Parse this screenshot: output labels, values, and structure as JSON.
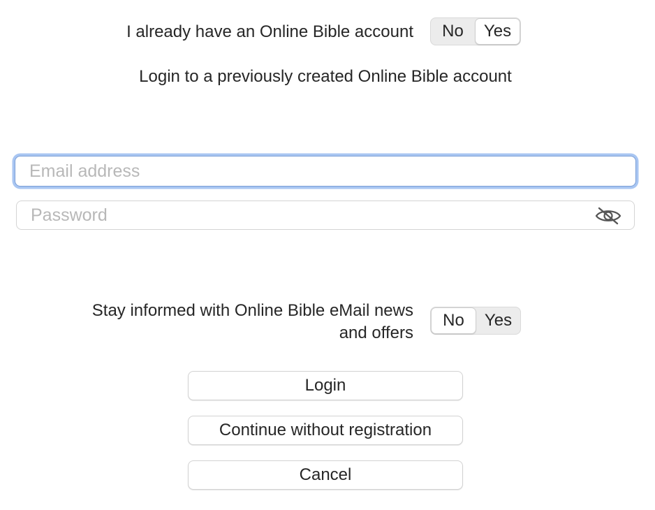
{
  "account": {
    "question": "I already have an Online Bible account",
    "toggle": {
      "options": [
        "No",
        "Yes"
      ],
      "selected": "Yes"
    },
    "subtitle": "Login to a previously created Online Bible account"
  },
  "form": {
    "email": {
      "placeholder": "Email address",
      "value": ""
    },
    "password": {
      "placeholder": "Password",
      "value": "",
      "toggle_icon": "eye-slash-icon"
    }
  },
  "newsletter": {
    "label_line1": "Stay informed with Online Bible eMail news",
    "label_line2": "and offers",
    "toggle": {
      "options": [
        "No",
        "Yes"
      ],
      "selected": "No"
    }
  },
  "buttons": {
    "login": "Login",
    "continue": "Continue without registration",
    "cancel": "Cancel"
  },
  "colors": {
    "focus_ring": "#a9c6f2",
    "segment_bg": "#ececec"
  }
}
